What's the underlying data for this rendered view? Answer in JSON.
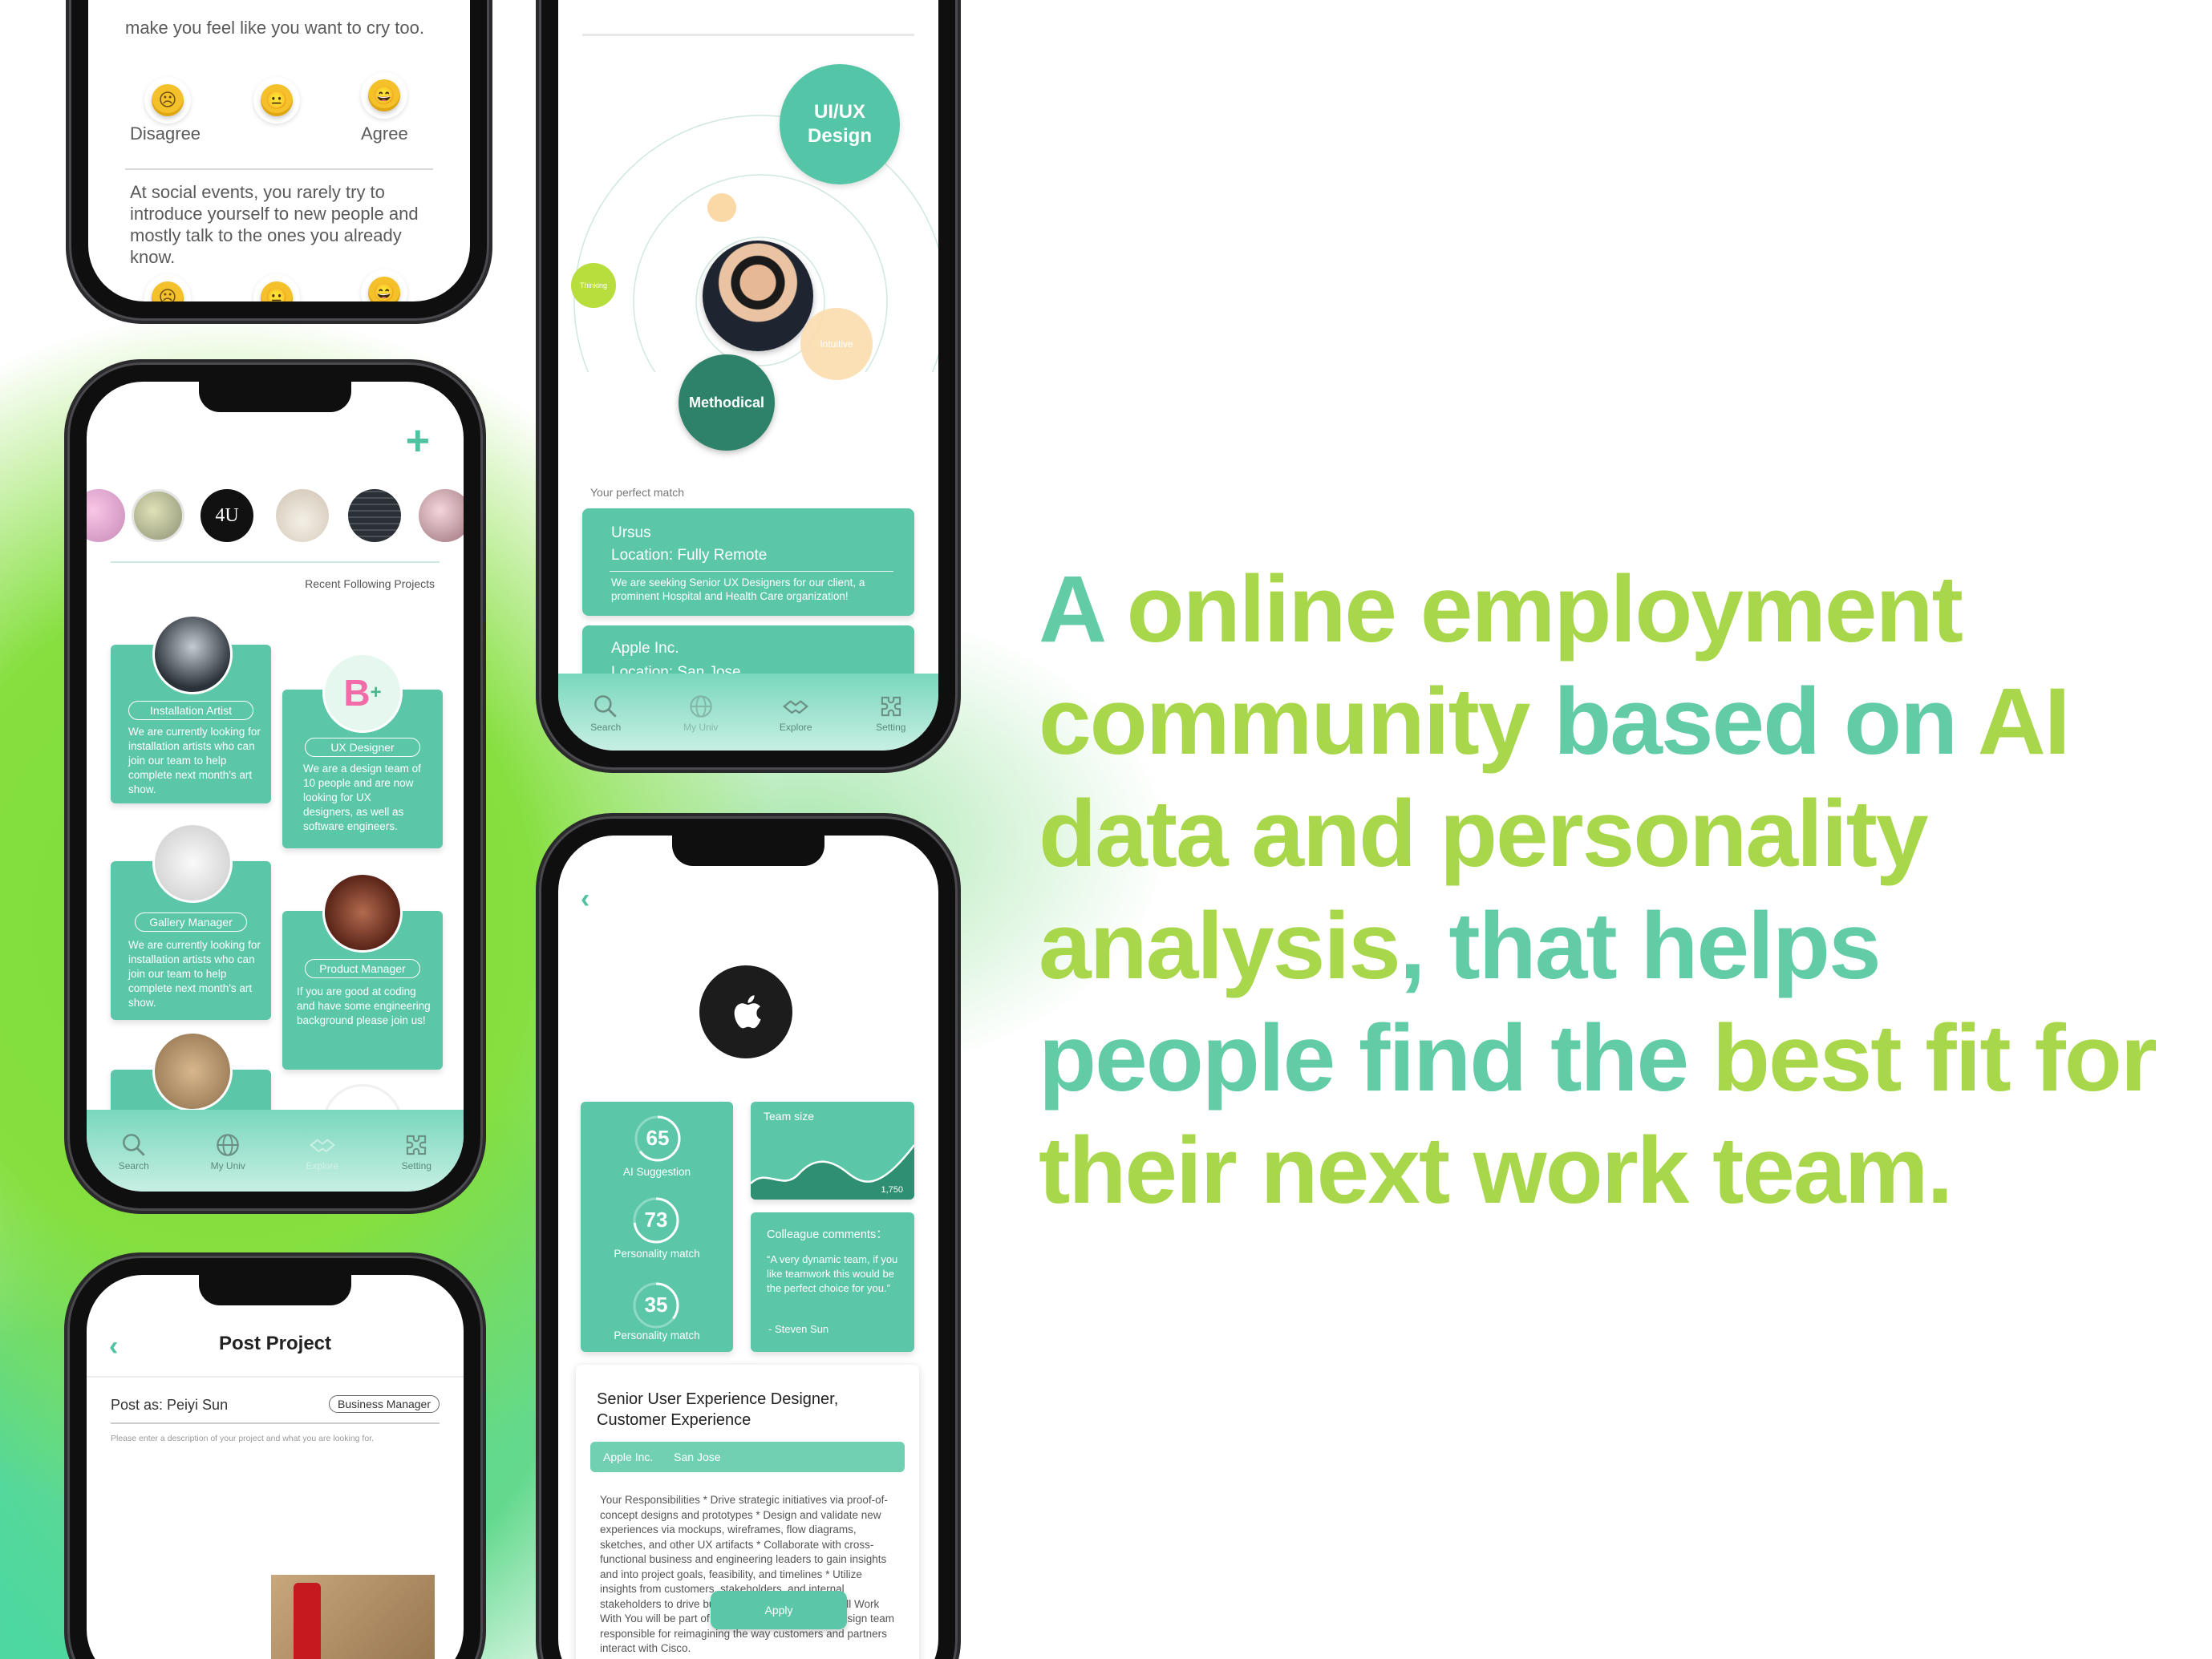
{
  "headline": {
    "s1": "A",
    "s2": " online employment community",
    "s3": " based on ",
    "s4": "AI data and personality analysis",
    "s5": ", that helps people find the ",
    "s6": "best fit for their next work team."
  },
  "quiz": {
    "q1": "make you feel like you want to cry too.",
    "disagree": "Disagree",
    "agree": "Agree",
    "q2": "At social events, you rarely try to introduce yourself to new people and mostly talk to the ones you already know."
  },
  "feed": {
    "add_icon": "+",
    "story_logo": "4U",
    "section_title": "Recent Following Projects",
    "cards": [
      {
        "role": "Installation Artist",
        "desc": "We are currently looking for installation artists who can join our team to help complete next month's art show."
      },
      {
        "role": "UX Designer",
        "desc": "We are a design team of 10 people and are now looking for UX designers, as well as software engineers."
      },
      {
        "role": "Gallery Manager",
        "desc": "We are currently looking for installation artists who can join our team to help complete next month's art show."
      },
      {
        "role": "Product Manager",
        "desc": "If you are good at coding and have some engineering background please join us!"
      }
    ]
  },
  "tabs": [
    "Search",
    "My Univ",
    "Explore",
    "Setting"
  ],
  "match": {
    "big_bubble": "UI/UX Design",
    "thinking": "Thinking",
    "intuitive": "Intuitive",
    "methodical": "Methodical",
    "perfect_match": "Your perfect match",
    "results": [
      {
        "company": "Ursus",
        "location": "Location: Fully Remote",
        "desc": "We are seeking Senior UX Designers for our client, a prominent Hospital and Health Care organization!"
      },
      {
        "company": "Apple Inc.",
        "location": "Location: San Jose"
      }
    ]
  },
  "job": {
    "ai_score": "65",
    "ai_label": "AI Suggestion",
    "pm_score": "73",
    "pm_label": "Personality match",
    "pm2_score": "35",
    "pm2_label": "Personality match",
    "team_size_label": "Team size",
    "team_size_value": "1,750",
    "comments_label": "Colleague comments：",
    "comment": "“A very dynamic team, if you like teamwork this would be the perfect choice for you.”",
    "comment_author": "- Steven Sun",
    "title": "Senior User Experience Designer, Customer Experience",
    "company": "Apple Inc.",
    "location": "San Jose",
    "description": "Your Responsibilities * Drive strategic initiatives via proof-of-concept designs and prototypes * Design and validate new experiences via mockups, wireframes, flow diagrams, sketches, and other UX artifacts * Collaborate with cross-functional business and engineering leaders to gain insights and into project goals, feasibility, and timelines * Utilize insights from customers, stakeholders, and internal stakeholders to drive business processes Who You'll Work With You will be part of an innovative experience design team responsible for reimagining the way customers and partners interact with Cisco.",
    "apply": "Apply"
  },
  "post": {
    "title": "Post Project",
    "post_as": "Post as: Peiyi Sun",
    "role_badge": "Business Manager",
    "placeholder": "Please enter a description of your project and what you are looking for."
  }
}
